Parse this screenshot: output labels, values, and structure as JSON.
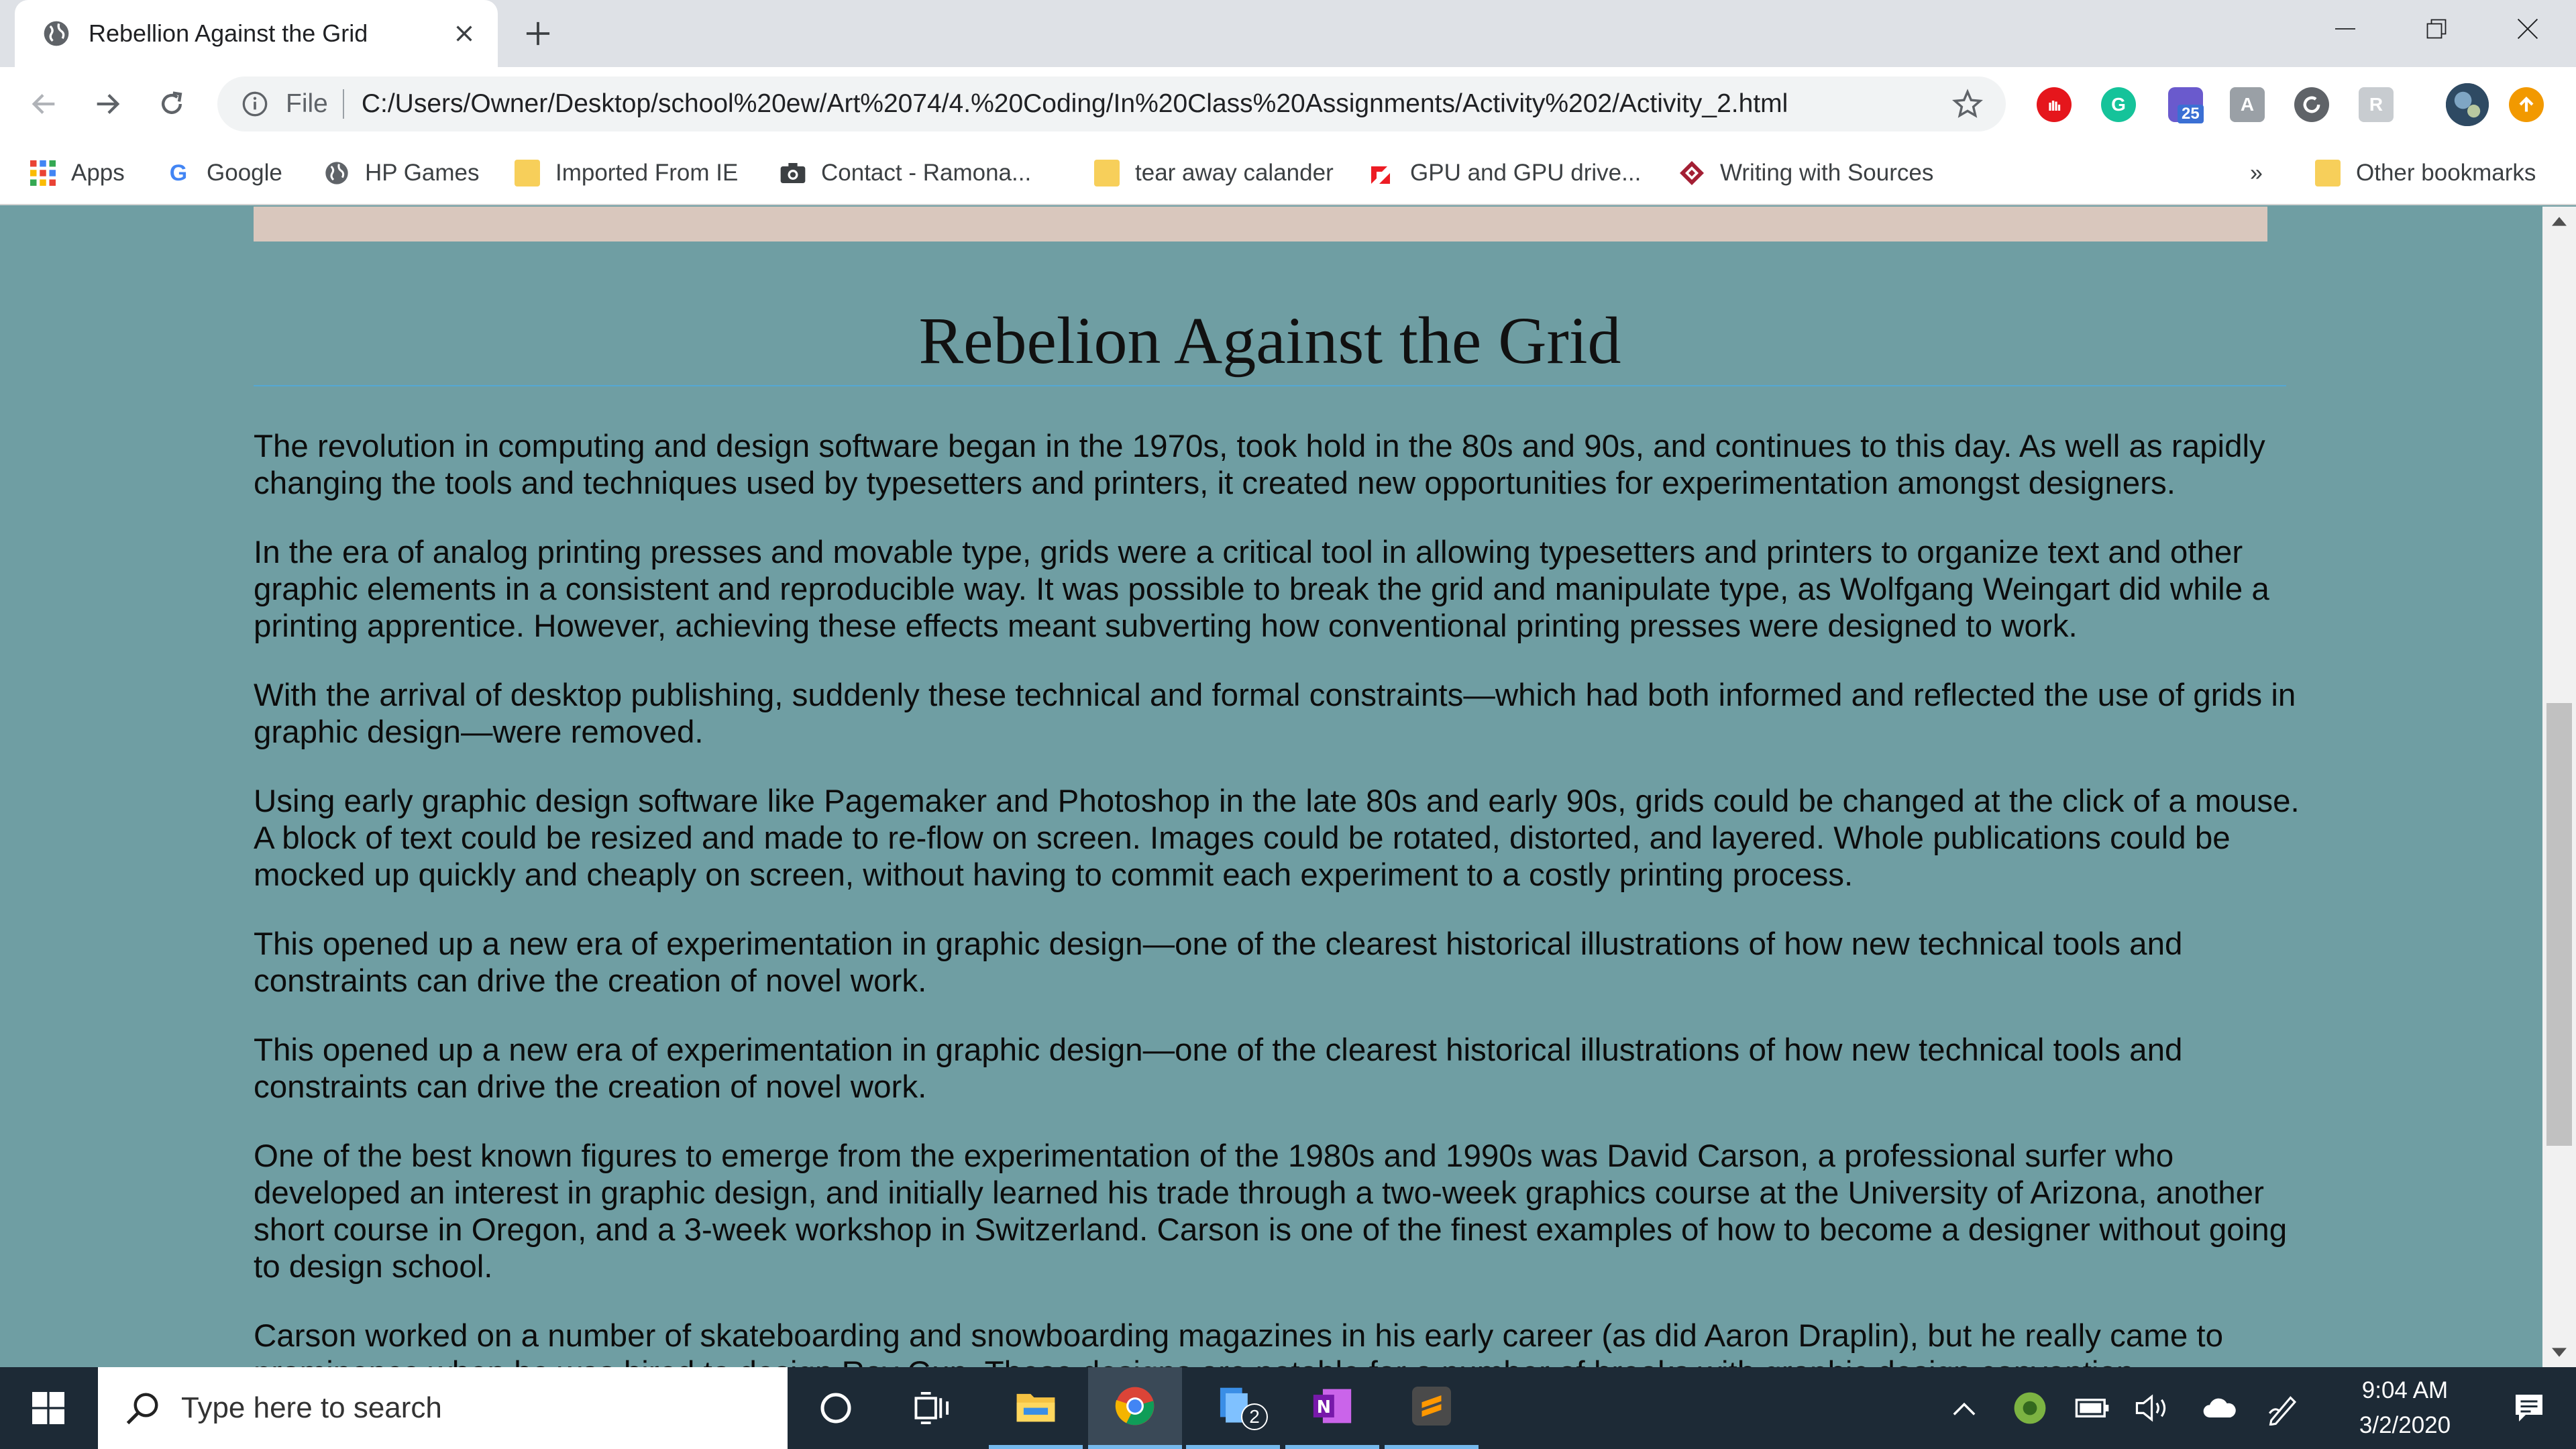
{
  "browser": {
    "tab": {
      "title": "Rebellion Against the Grid"
    },
    "omnibox": {
      "scheme": "File",
      "url": "C:/Users/Owner/Desktop/school%20ew/Art%2074/4.%20Coding/In%20Class%20Assignments/Activity%202/Activity_2.html"
    },
    "extension_badge": "25",
    "bookmarks": [
      {
        "label": "Apps",
        "icon": "apps-grid-icon"
      },
      {
        "label": "Google",
        "icon": "google-icon"
      },
      {
        "label": "HP Games",
        "icon": "globe-icon"
      },
      {
        "label": "Imported From IE",
        "icon": "folder-icon"
      },
      {
        "label": "Contact - Ramona...",
        "icon": "camera-icon"
      },
      {
        "label": "tear away calander",
        "icon": "folder-icon"
      },
      {
        "label": "GPU and GPU drive...",
        "icon": "amd-icon"
      },
      {
        "label": "Writing with Sources",
        "icon": "diamond-icon"
      }
    ],
    "bookmarks_overflow": "»",
    "other_bookmarks": "Other bookmarks"
  },
  "page": {
    "title": "Rebelion Against the Grid",
    "paragraphs": [
      "The revolution in computing and design software began in the 1970s, took hold in the 80s and 90s, and continues to this day. As well as rapidly changing the tools and techniques used by typesetters and printers, it created new opportunities for experimentation amongst designers.",
      "In the era of analog printing presses and movable type, grids were a critical tool in allowing typesetters and printers to organize text and other graphic elements in a consistent and reproducible way. It was possible to break the grid and manipulate type, as Wolfgang Weingart did while a printing apprentice. However, achieving these effects meant subverting how conventional printing presses were designed to work.",
      "With the arrival of desktop publishing, suddenly these technical and formal constraints—which had both informed and reflected the use of grids in graphic design—were removed.",
      "Using early graphic design software like Pagemaker and Photoshop in the late 80s and early 90s, grids could be changed at the click of a mouse. A block of text could be resized and made to re-flow on screen. Images could be rotated, distorted, and layered. Whole publications could be mocked up quickly and cheaply on screen, without having to commit each experiment to a costly printing process.",
      "This opened up a new era of experimentation in graphic design—one of the clearest historical illustrations of how new technical tools and constraints can drive the creation of novel work.",
      "This opened up a new era of experimentation in graphic design—one of the clearest historical illustrations of how new technical tools and constraints can drive the creation of novel work.",
      "One of the best known figures to emerge from the experimentation of the 1980s and 1990s was David Carson, a professional surfer who developed an interest in graphic design, and initially learned his trade through a two-week graphics course at the University of Arizona, another short course in Oregon, and a 3-week workshop in Switzerland. Carson is one of the finest examples of how to become a designer without going to design school.",
      "Carson worked on a number of skateboarding and snowboarding magazines in his early career (as did Aaron Draplin), but he really came to prominence when he was hired to design Ray Gun. These designs are notable for a number of breaks with graphic design convention."
    ]
  },
  "taskbar": {
    "search_placeholder": "Type here to search",
    "file_explorer_badge": "2",
    "time": "9:04 AM",
    "date": "3/2/2020"
  },
  "colors": {
    "page_background": "#6f9ea3",
    "title_rule": "#55a7d3",
    "hero_strip": "#d9c7bd",
    "taskbar": "#1d2a36"
  }
}
